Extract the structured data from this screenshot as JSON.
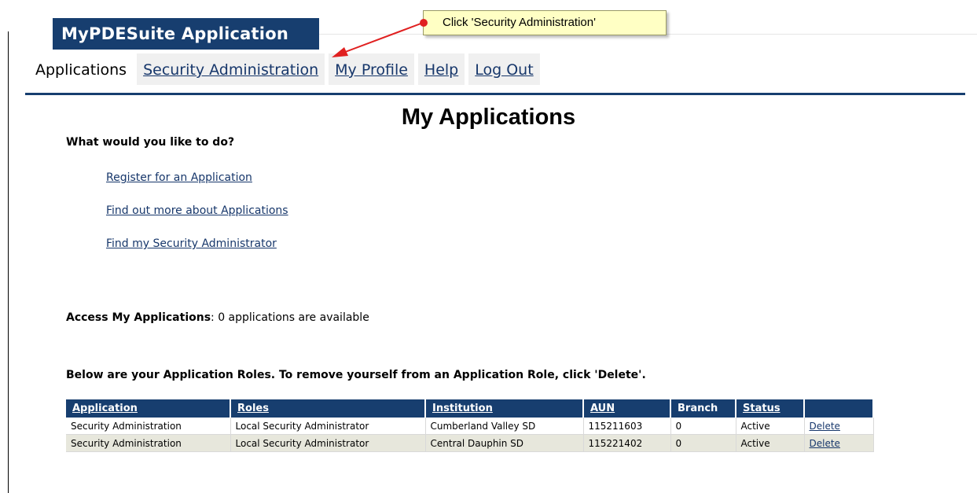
{
  "header": {
    "app_title": "MyPDESuite Application"
  },
  "nav": {
    "current": "Applications",
    "links": [
      "Security Administration",
      "My Profile",
      "Help",
      "Log Out"
    ]
  },
  "callout": {
    "text": "Click 'Security Administration'"
  },
  "page": {
    "title": "My Applications",
    "question": "What would you like to do?",
    "actions": [
      "Register for an Application",
      "Find out more about Applications",
      "Find my Security Administrator"
    ],
    "access_label": "Access My Applications",
    "access_text": ": 0 applications are available",
    "roles_note": "Below are your Application Roles. To remove yourself from an Application Role, click 'Delete'."
  },
  "table": {
    "headers": [
      "Application",
      "Roles",
      "Institution",
      "AUN",
      "Branch",
      "Status",
      ""
    ],
    "rows": [
      [
        "Security Administration",
        "Local Security Administrator",
        "Cumberland Valley SD",
        "115211603",
        "0",
        "Active",
        "Delete"
      ],
      [
        "Security Administration",
        "Local Security Administrator",
        "Central Dauphin SD",
        "115221402",
        "0",
        "Active",
        "Delete"
      ]
    ]
  },
  "colors": {
    "brand_navy": "#173e6f",
    "callout_bg": "#ffffc4",
    "arrow_red": "#e02020"
  }
}
